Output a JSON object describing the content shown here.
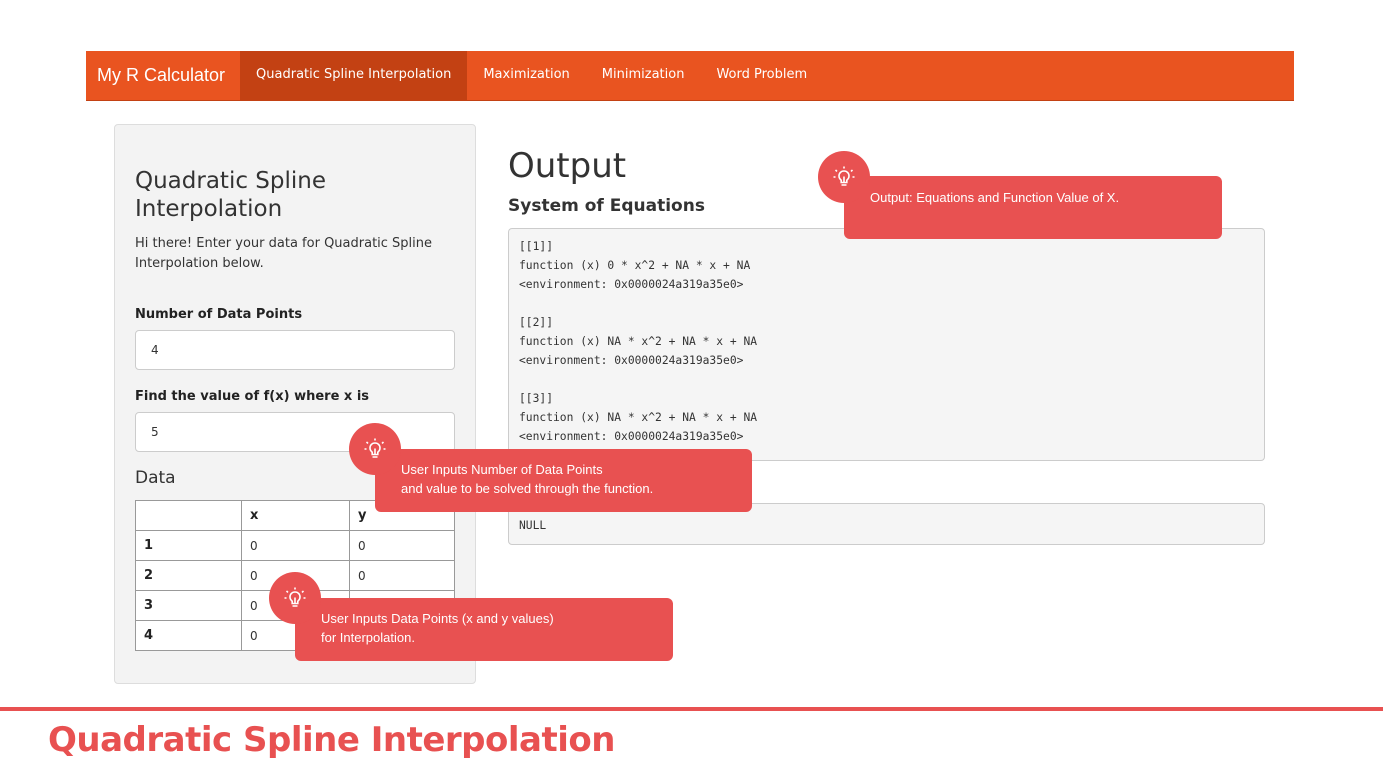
{
  "navbar": {
    "brand": "My R Calculator",
    "items": [
      {
        "label": "Quadratic Spline Interpolation",
        "active": true
      },
      {
        "label": "Maximization",
        "active": false
      },
      {
        "label": "Minimization",
        "active": false
      },
      {
        "label": "Word Problem",
        "active": false
      }
    ]
  },
  "sidebar": {
    "title": "Quadratic Spline Interpolation",
    "description": "Hi there! Enter your data for Quadratic Spline Interpolation below.",
    "num_points_label": "Number of Data Points",
    "num_points_value": "4",
    "find_label": "Find the value of f(x) where x is",
    "find_value": "5",
    "data_heading": "Data",
    "table": {
      "headers": [
        "",
        "x",
        "y"
      ],
      "rows": [
        [
          "1",
          "0",
          "0"
        ],
        [
          "2",
          "0",
          "0"
        ],
        [
          "3",
          "0",
          ""
        ],
        [
          "4",
          "0",
          ""
        ]
      ]
    }
  },
  "output": {
    "title": "Output",
    "system_title": "System of Equations",
    "equations_text": "[[1]]\nfunction (x) 0 * x^2 + NA * x + NA\n<environment: 0x0000024a319a35e0>\n\n[[2]]\nfunction (x) NA * x^2 + NA * x + NA\n<environment: 0x0000024a319a35e0>\n\n[[3]]\nfunction (x) NA * x^2 + NA * x + NA\n<environment: 0x0000024a319a35e0>",
    "function_value_text": "NULL"
  },
  "callouts": {
    "output": "Output: Equations and Function Value of X.",
    "inputs_line1": "User Inputs Number of Data Points",
    "inputs_line2": "and value to be solved through the function.",
    "data_line1": "User Inputs Data Points (x and y values)",
    "data_line2": "for Interpolation."
  },
  "footer": {
    "title": "Quadratic Spline Interpolation"
  },
  "colors": {
    "navbar": "#e95420",
    "navbar_active": "#c34113",
    "accent": "#e85151"
  }
}
